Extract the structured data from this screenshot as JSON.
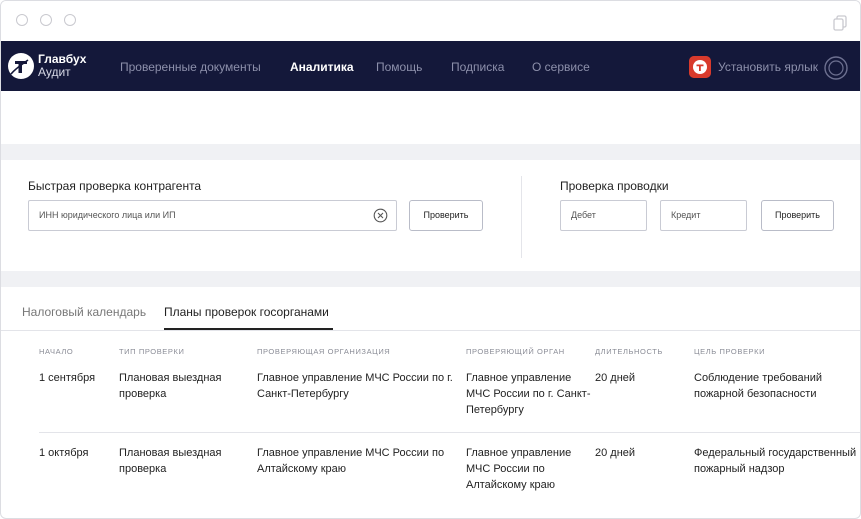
{
  "nav": {
    "brand_line1": "Главбух",
    "brand_line2": "Аудит",
    "items": [
      {
        "label": "Проверенные документы"
      },
      {
        "label": "Аналитика"
      },
      {
        "label": "Помощь"
      },
      {
        "label": "Подписка"
      },
      {
        "label": "О сервисе"
      }
    ],
    "active_item": "Аналитика",
    "shortcut_label": "Установить ярлык"
  },
  "quick_check": {
    "title": "Быстрая проверка контрагента",
    "input_placeholder": "ИНН юридического лица или ИП",
    "button_label": "Проверить"
  },
  "posting_check": {
    "title": "Проверка проводки",
    "debit_placeholder": "Дебет",
    "credit_placeholder": "Кредит",
    "button_label": "Проверить"
  },
  "tabs": [
    {
      "label": "Налоговый календарь",
      "active": false
    },
    {
      "label": "Планы проверок госорганами",
      "active": true
    }
  ],
  "table": {
    "columns": [
      "НАЧАЛО",
      "ТИП ПРОВЕРКИ",
      "ПРОВЕРЯЮЩАЯ ОРГАНИЗАЦИЯ",
      "ПРОВЕРЯЮЩИЙ ОРГАН",
      "ДЛИТЕЛЬНОСТЬ",
      "ЦЕЛЬ ПРОВЕРКИ"
    ],
    "rows": [
      {
        "start": "1 сентября",
        "type": "Плановая выездная проверка",
        "organization": "Главное управление МЧС России по г. Санкт-Петербургу",
        "authority": "Главное управление МЧС России по г. Санкт-Петербургу",
        "duration": "20 дней",
        "purpose": "Соблюдение требований пожарной безопасности"
      },
      {
        "start": "1 октября",
        "type": "Плановая выездная проверка",
        "organization": "Главное управление МЧС России по Алтайскому краю",
        "authority": "Главное управление МЧС России по Алтайскому краю",
        "duration": "20 дней",
        "purpose": "Федеральный государственный пожарный надзор"
      }
    ]
  },
  "icons": {
    "logo": "glavbukh-logo-icon",
    "shortcut": "app-shortcut-icon",
    "ring": "ring-icon",
    "clear": "clear-circle-icon",
    "copy": "copy-icon"
  },
  "colors": {
    "navbar": "#14183a",
    "accent_red": "#d83a2c",
    "band": "#f0f1f4"
  }
}
